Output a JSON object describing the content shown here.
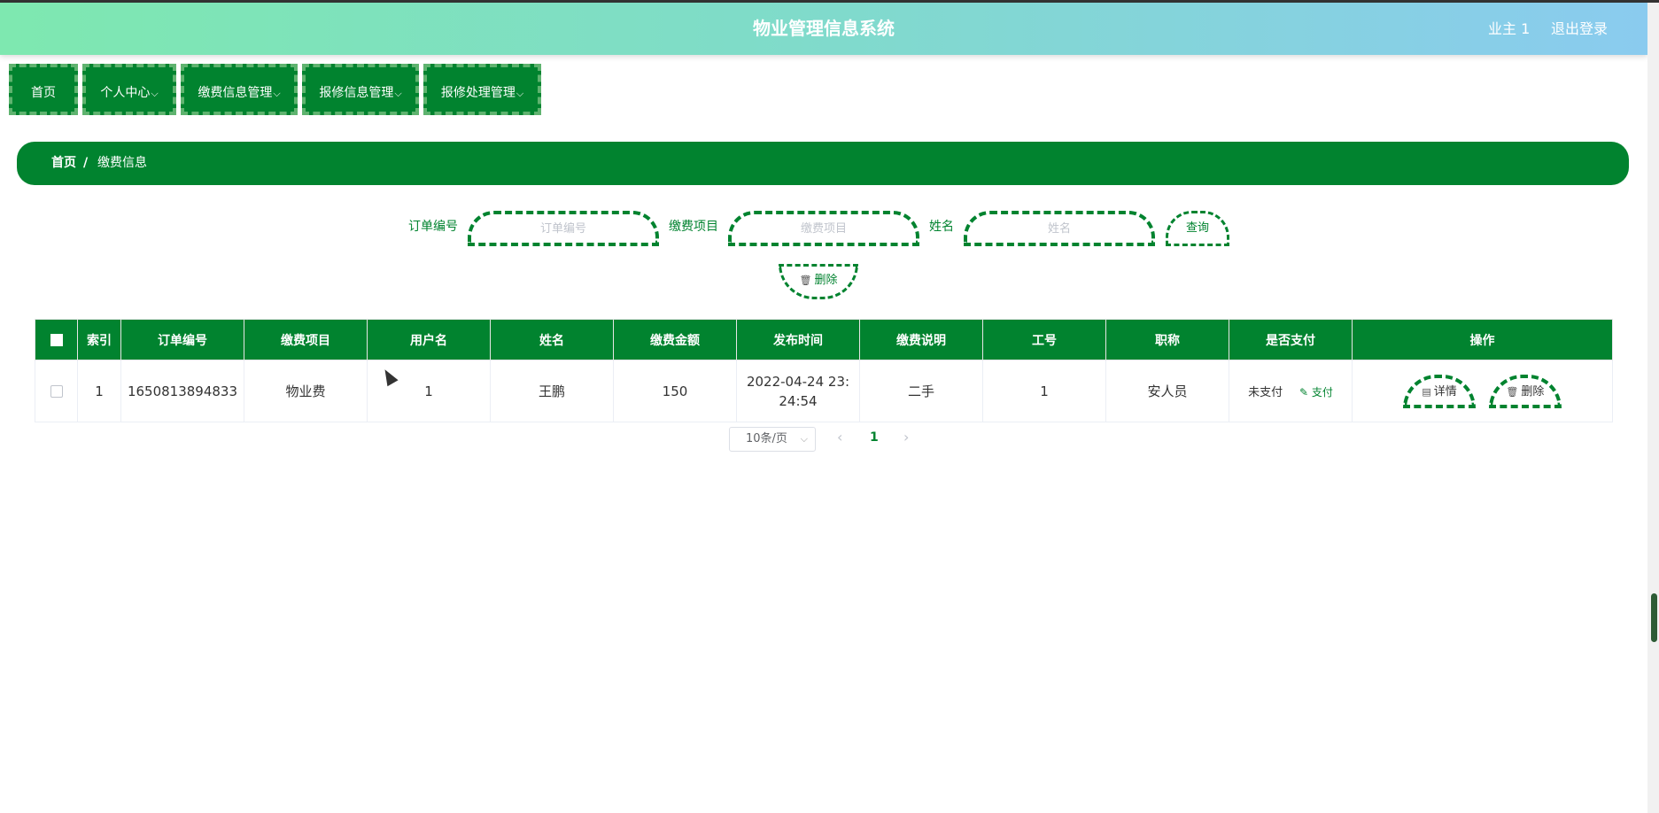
{
  "header": {
    "title": "物业管理信息系统",
    "user": "业主 1",
    "logout": "退出登录"
  },
  "nav": {
    "items": [
      {
        "label": "首页",
        "chevron": ""
      },
      {
        "label": "个人中心",
        "chevron": "⌵"
      },
      {
        "label": "缴费信息管理",
        "chevron": "⌵"
      },
      {
        "label": "报修信息管理",
        "chevron": "⌵"
      },
      {
        "label": "报修处理管理",
        "chevron": "⌵"
      }
    ]
  },
  "breadcrumb": {
    "home": "首页",
    "separator": "/",
    "current": "缴费信息"
  },
  "search": {
    "order_label": "订单编号",
    "order_placeholder": "订单编号",
    "project_label": "缴费项目",
    "project_placeholder": "缴费项目",
    "name_label": "姓名",
    "name_placeholder": "姓名",
    "query_button": "查询",
    "delete_button": "删除"
  },
  "table": {
    "headers": [
      "索引",
      "订单编号",
      "缴费项目",
      "用户名",
      "姓名",
      "缴费金额",
      "发布时间",
      "缴费说明",
      "工号",
      "职称",
      "是否支付",
      "操作"
    ],
    "rows": [
      {
        "index": "1",
        "order_no": "1650813894833",
        "project": "物业费",
        "username": "1",
        "name": "王鹏",
        "amount": "150",
        "time": "2022-04-24 23:24:54",
        "description": "二手",
        "job_no": "1",
        "title": "安人员",
        "paid": "未支付",
        "pay_action": "支付",
        "detail_button": "详情",
        "delete_button": "删除"
      }
    ]
  },
  "pagination": {
    "page_size": "10条/页",
    "current_page": "1"
  },
  "icons": {
    "trash": "trash-icon",
    "doc": "document-icon",
    "edit": "edit-icon"
  },
  "colors": {
    "primary": "#01832f",
    "header_gradient_start": "#7ee8b0",
    "header_gradient_end": "#8acbef"
  }
}
